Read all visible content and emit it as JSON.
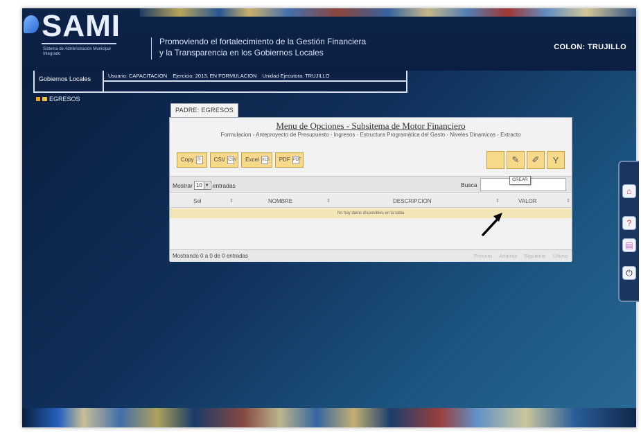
{
  "header": {
    "logo_text": "SAMI",
    "logo_subtitle": "Sistema de Administración Municipal Integrado",
    "tagline_line1": "Promoviendo el fortalecimiento de la Gestión Financiera",
    "tagline_line2": "y la Transparencia en los Gobiernos Locales",
    "user_location": "COLON: TRUJILLO"
  },
  "infobar": {
    "module": "Gobiernos Locales",
    "user": "Usuario: CAPACITACION",
    "exercise": "Ejercicio: 2013, EN FORMULACION",
    "unit": "Unidad Ejecutora: TRUJILLO"
  },
  "tree": {
    "item_label": "EGRESOS"
  },
  "panel": {
    "tab_label": "PADRE: EGRESOS",
    "menu_title": "Menu de Opciones - Subsitema de Motor Financiero",
    "menu_links": "Formulacion - Anteproyecto de Presupuesto - Ingresos - Estructura Programática del Gasto - Niveles Dinamicos - Extracto",
    "toolbar": [
      {
        "label": "Copy",
        "icon": "copy-icon",
        "glyph": "⎘"
      },
      {
        "label": "CSV",
        "icon": "csv-icon",
        "glyph": "CSV"
      },
      {
        "label": "Excel",
        "icon": "excel-icon",
        "glyph": "XLS"
      },
      {
        "label": "PDF",
        "icon": "pdf-icon",
        "glyph": "PDF"
      }
    ],
    "icon_buttons": [
      {
        "name": "new-document-icon",
        "glyph": ""
      },
      {
        "name": "edit-pencil-icon",
        "glyph": "✎"
      },
      {
        "name": "wrench-icon",
        "glyph": "✐"
      },
      {
        "name": "filter-icon",
        "glyph": "Y"
      }
    ],
    "show_label_before": "Mostrar",
    "page_size": "10",
    "show_label_after": "entradas",
    "search_label": "Busca",
    "search_value": "",
    "search_tooltip": "CREAR",
    "columns": [
      "Sel",
      "NOMBRE",
      "DESCRIPCION",
      "VALOR"
    ],
    "empty_message": "No hay datos disponibles en la tabla",
    "table_info": "Mostrando 0 a 0 de 0 entradas",
    "pagination": [
      "Primero",
      "Anterior",
      "Siguiente",
      "Último"
    ]
  },
  "side_panel": {
    "icons": [
      {
        "name": "home-icon",
        "glyph": "⌂",
        "color": "#d04040"
      },
      {
        "name": "help-icon",
        "glyph": "?",
        "color": "#d04040"
      },
      {
        "name": "document-icon",
        "glyph": "▤",
        "color": "#c060c0"
      },
      {
        "name": "power-icon",
        "glyph": "⏻",
        "color": "#202020"
      }
    ]
  },
  "colors": {
    "background": "#10305a",
    "button_yellow": "#f7d98a",
    "empty_row": "#f2e6b8"
  }
}
